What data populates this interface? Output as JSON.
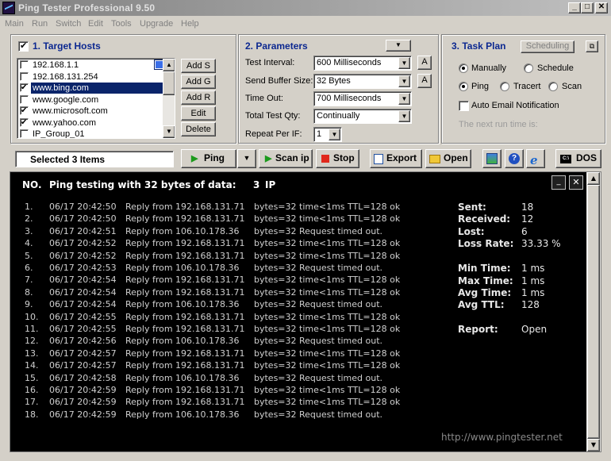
{
  "window": {
    "title": "Ping Tester   Professional  9.50"
  },
  "menu": [
    "Main",
    "Run",
    "Switch",
    "Edit",
    "Tools",
    "Upgrade",
    "Help"
  ],
  "target_hosts": {
    "title": "1. Target Hosts",
    "enabled": true,
    "hosts": [
      {
        "name": "192.168.1.1",
        "checked": false,
        "selected": false
      },
      {
        "name": "192.168.131.254",
        "checked": false,
        "selected": false
      },
      {
        "name": "www.bing.com",
        "checked": true,
        "selected": true
      },
      {
        "name": "www.google.com",
        "checked": false,
        "selected": false
      },
      {
        "name": "www.microsoft.com",
        "checked": true,
        "selected": false
      },
      {
        "name": "www.yahoo.com",
        "checked": true,
        "selected": false
      },
      {
        "name": "IP_Group_01",
        "checked": false,
        "selected": false
      }
    ],
    "buttons": [
      "Add S",
      "Add G",
      "Add R",
      "Edit",
      "Delete"
    ]
  },
  "parameters": {
    "title": "2. Parameters",
    "fields": [
      {
        "label": "Test Interval:",
        "value": "600 Milliseconds",
        "has_a": true
      },
      {
        "label": "Send Buffer Size:",
        "value": "32  Bytes",
        "has_a": true
      },
      {
        "label": "Time Out:",
        "value": "700 Milliseconds",
        "has_a": false
      },
      {
        "label": "Total Test Qty:",
        "value": "Continually",
        "has_a": false
      },
      {
        "label": "Repeat Per IF:",
        "value": "1",
        "has_a": false
      }
    ],
    "a_label": "A"
  },
  "task_plan": {
    "title": "3. Task Plan",
    "scheduling_label": "Scheduling",
    "mode_options": [
      {
        "label": "Manually",
        "selected": true
      },
      {
        "label": "Schedule",
        "selected": false
      }
    ],
    "type_options": [
      {
        "label": "Ping",
        "selected": true
      },
      {
        "label": "Tracert",
        "selected": false
      },
      {
        "label": "Scan",
        "selected": false
      }
    ],
    "auto_email_label": "Auto Email Notification",
    "auto_email_checked": false,
    "next_run_text": "The next run time is:"
  },
  "toolbar": {
    "selected_text": "Selected 3 Items",
    "ping": "Ping",
    "scan_ip": "Scan ip",
    "stop": "Stop",
    "export": "Export",
    "open": "Open",
    "dos": "DOS"
  },
  "output": {
    "header_no": "NO.",
    "header_text": "Ping testing with 32 bytes of data:",
    "header_count": "3",
    "header_ip": "IP",
    "rows": [
      [
        "1.",
        "06/17 20:42:50",
        "Reply from 192.168.131.71",
        "bytes=32  time<1ms  TTL=128  ok"
      ],
      [
        "2.",
        "06/17 20:42:50",
        "Reply from 192.168.131.71",
        "bytes=32  time<1ms  TTL=128  ok"
      ],
      [
        "3.",
        "06/17 20:42:51",
        "Reply from 106.10.178.36",
        "bytes=32  Request  timed  out."
      ],
      [
        "4.",
        "06/17 20:42:52",
        "Reply from 192.168.131.71",
        "bytes=32  time<1ms  TTL=128  ok"
      ],
      [
        "5.",
        "06/17 20:42:52",
        "Reply from 192.168.131.71",
        "bytes=32  time<1ms  TTL=128  ok"
      ],
      [
        "6.",
        "06/17 20:42:53",
        "Reply from 106.10.178.36",
        "bytes=32  Request  timed  out."
      ],
      [
        "7.",
        "06/17 20:42:54",
        "Reply from 192.168.131.71",
        "bytes=32  time<1ms  TTL=128  ok"
      ],
      [
        "8.",
        "06/17 20:42:54",
        "Reply from 192.168.131.71",
        "bytes=32  time<1ms  TTL=128  ok"
      ],
      [
        "9.",
        "06/17 20:42:54",
        "Reply from 106.10.178.36",
        "bytes=32  Request  timed  out."
      ],
      [
        "10.",
        "06/17 20:42:55",
        "Reply from 192.168.131.71",
        "bytes=32  time<1ms  TTL=128  ok"
      ],
      [
        "11.",
        "06/17 20:42:55",
        "Reply from 192.168.131.71",
        "bytes=32  time<1ms  TTL=128  ok"
      ],
      [
        "12.",
        "06/17 20:42:56",
        "Reply from 106.10.178.36",
        "bytes=32  Request  timed  out."
      ],
      [
        "13.",
        "06/17 20:42:57",
        "Reply from 192.168.131.71",
        "bytes=32  time<1ms  TTL=128  ok"
      ],
      [
        "14.",
        "06/17 20:42:57",
        "Reply from 192.168.131.71",
        "bytes=32  time<1ms  TTL=128  ok"
      ],
      [
        "15.",
        "06/17 20:42:58",
        "Reply from 106.10.178.36",
        "bytes=32  Request  timed  out."
      ],
      [
        "16.",
        "06/17 20:42:59",
        "Reply from 192.168.131.71",
        "bytes=32  time<1ms  TTL=128  ok"
      ],
      [
        "17.",
        "06/17 20:42:59",
        "Reply from 192.168.131.71",
        "bytes=32  time<1ms  TTL=128  ok"
      ],
      [
        "18.",
        "06/17 20:42:59",
        "Reply from 106.10.178.36",
        "bytes=32  Request  timed  out."
      ]
    ],
    "stats": [
      {
        "key": "Sent:",
        "value": "18"
      },
      {
        "key": "Received:",
        "value": "12"
      },
      {
        "key": "Lost:",
        "value": "6"
      },
      {
        "key": "Loss Rate:",
        "value": "33.33 %"
      },
      {
        "key": "Min Time:",
        "value": "1 ms"
      },
      {
        "key": "Max Time:",
        "value": "1 ms"
      },
      {
        "key": "Avg Time:",
        "value": "1 ms"
      },
      {
        "key": "Avg TTL:",
        "value": "128"
      },
      {
        "key": "Report:",
        "value": "Open"
      }
    ],
    "url": "http://www.pingtester.net"
  },
  "colors": {
    "group_title": "#0c2890",
    "selection": "#0a246a",
    "console_bg": "#000000"
  }
}
